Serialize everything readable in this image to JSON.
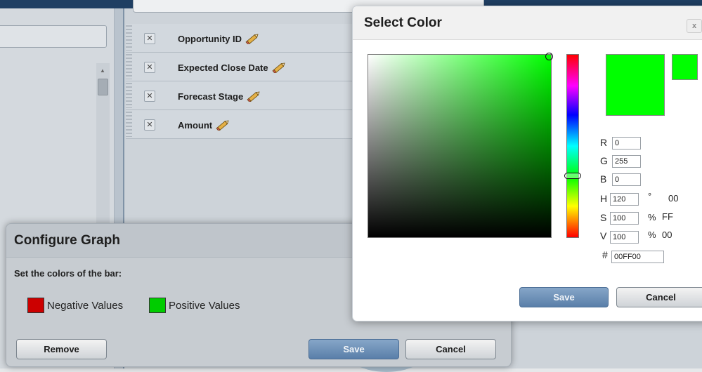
{
  "fields": [
    {
      "label": "Opportunity ID"
    },
    {
      "label": "Expected Close Date"
    },
    {
      "label": "Forecast Stage"
    },
    {
      "label": "Amount"
    }
  ],
  "field_remove_glyph": "✕",
  "configure_graph": {
    "title": "Configure Graph",
    "prompt": "Set the colors of the bar:",
    "negative": {
      "label": "Negative Values",
      "color": "#cc0000"
    },
    "positive": {
      "label": "Positive Values",
      "color": "#00cc00"
    },
    "remove_label": "Remove",
    "save_label": "Save",
    "cancel_label": "Cancel"
  },
  "select_color": {
    "title": "Select Color",
    "close_glyph": "x",
    "new_color": "#00ff00",
    "current_color": "#00ff00",
    "r_label": "R",
    "r_value": "0",
    "g_label": "G",
    "g_value": "255",
    "b_label": "B",
    "b_value": "0",
    "h_label": "H",
    "h_value": "120",
    "h_unit": "°",
    "h_hex": "00",
    "s_label": "S",
    "s_value": "100",
    "s_unit": "%",
    "s_hex": "FF",
    "v_label": "V",
    "v_value": "100",
    "v_unit": "%",
    "v_hex": "00",
    "hex_label": "#",
    "hex_value": "00FF00",
    "save_label": "Save",
    "cancel_label": "Cancel"
  }
}
